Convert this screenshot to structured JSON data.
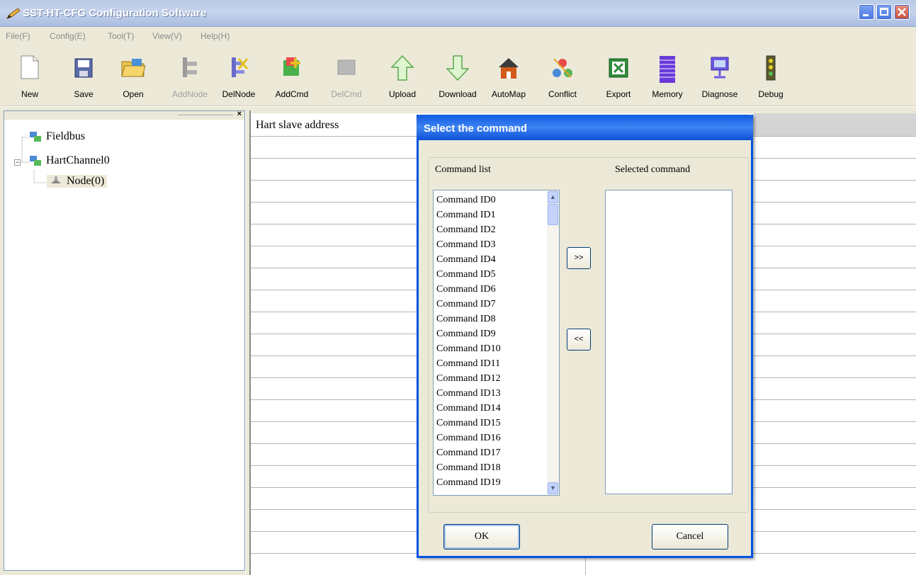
{
  "window": {
    "title": "SST-HT-CFG Configuration Software"
  },
  "menu": [
    {
      "label": "File(F)"
    },
    {
      "label": "Config(E)"
    },
    {
      "label": "Tool(T)"
    },
    {
      "label": "View(V)"
    },
    {
      "label": "Help(H)"
    }
  ],
  "toolbar": [
    {
      "label": "New",
      "icon": "new-file-icon",
      "enabled": true
    },
    {
      "label": "Save",
      "icon": "save-icon",
      "enabled": true
    },
    {
      "label": "Open",
      "icon": "open-folder-icon",
      "enabled": true
    },
    {
      "label": "AddNode",
      "icon": "add-node-icon",
      "enabled": false
    },
    {
      "label": "DelNode",
      "icon": "delete-node-icon",
      "enabled": true
    },
    {
      "label": "AddCmd",
      "icon": "add-command-icon",
      "enabled": true
    },
    {
      "label": "DelCmd",
      "icon": "delete-command-icon",
      "enabled": false
    },
    {
      "label": "Upload",
      "icon": "upload-arrow-icon",
      "enabled": true
    },
    {
      "label": "Download",
      "icon": "download-arrow-icon",
      "enabled": true
    },
    {
      "label": "AutoMap",
      "icon": "house-icon",
      "enabled": true
    },
    {
      "label": "Conflict",
      "icon": "conflict-icon",
      "enabled": true
    },
    {
      "label": "Export",
      "icon": "excel-icon",
      "enabled": true
    },
    {
      "label": "Memory",
      "icon": "memory-icon",
      "enabled": true
    },
    {
      "label": "Diagnose",
      "icon": "diagnose-icon",
      "enabled": true
    },
    {
      "label": "Debug",
      "icon": "debug-icon",
      "enabled": true
    }
  ],
  "tree": {
    "items": [
      {
        "label": "Fieldbus"
      },
      {
        "label": "HartChannel0",
        "expander": "−"
      },
      {
        "label": "Node(0)"
      }
    ]
  },
  "grid": {
    "column_header": "Hart slave address"
  },
  "dialog": {
    "title": "Select the command",
    "list_label": "Command list",
    "selected_label": "Selected command",
    "commands": [
      "Command ID0",
      "Command ID1",
      "Command ID2",
      "Command ID3",
      "Command ID4",
      "Command ID5",
      "Command ID6",
      "Command ID7",
      "Command ID8",
      "Command ID9",
      "Command ID10",
      "Command ID11",
      "Command ID12",
      "Command ID13",
      "Command ID14",
      "Command ID15",
      "Command ID16",
      "Command ID17",
      "Command ID18",
      "Command ID19"
    ],
    "add_button": ">>",
    "remove_button": "<<",
    "ok_button": "OK",
    "cancel_button": "Cancel"
  },
  "colors": {
    "titlebar_accent": "#0054e3",
    "face": "#ece9d8"
  }
}
